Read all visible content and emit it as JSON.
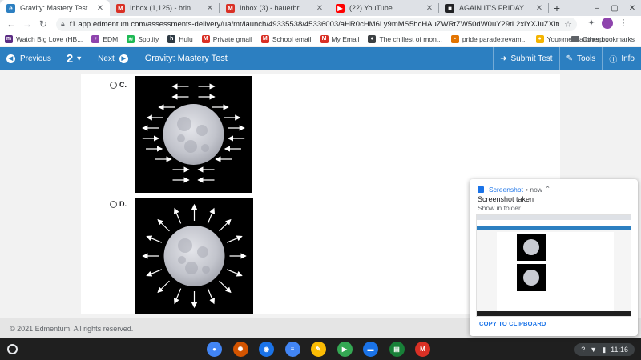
{
  "browser": {
    "tabs": [
      {
        "label": "Gravity: Mastery Test",
        "icon": "edmentum-icon",
        "active": true,
        "color": "#2c7fc1",
        "glyph": "e"
      },
      {
        "label": "Inbox (1,125) - brinnleybauer07",
        "icon": "gmail-icon",
        "active": false,
        "color": "#d93025",
        "glyph": "M"
      },
      {
        "label": "Inbox (3) - bauerbri6111@stude",
        "icon": "gmail-icon",
        "active": false,
        "color": "#d93025",
        "glyph": "M"
      },
      {
        "label": "(22) YouTube",
        "icon": "youtube-icon",
        "active": false,
        "color": "#ff0000",
        "glyph": "▶"
      },
      {
        "label": "AGAIN IT'S FRIDAY PEEPS (keyb",
        "icon": "page-icon",
        "active": false,
        "color": "#202124",
        "glyph": "■"
      }
    ],
    "new_tab": "+",
    "url": "f1.app.edmentum.com/assessments-delivery/ua/mt/launch/49335538/45336003/aHR0cHM6Ly9mMS5hcHAuZWRtZW50dW0uY29tL2xlYXJuZXItdWkvdXNlci1hc3NpZ25...",
    "bookmarks": [
      {
        "label": "Watch Big Love (HB...",
        "icon": "hbo-icon",
        "color": "#5b2c83",
        "glyph": "m"
      },
      {
        "label": "EDM",
        "icon": "edm-icon",
        "color": "#8e44ad",
        "glyph": "♀"
      },
      {
        "label": "Spotify",
        "icon": "spotify-icon",
        "color": "#1db954",
        "glyph": "≋"
      },
      {
        "label": "Hulu",
        "icon": "hulu-icon",
        "color": "#2f3b45",
        "glyph": "h"
      },
      {
        "label": "Private gmail",
        "icon": "gmail-icon",
        "color": "#d93025",
        "glyph": "M"
      },
      {
        "label": "School email",
        "icon": "gmail-icon",
        "color": "#d93025",
        "glyph": "M"
      },
      {
        "label": "My Email",
        "icon": "gmail-icon",
        "color": "#d93025",
        "glyph": "M"
      },
      {
        "label": "The chillest of mon...",
        "icon": "web-icon",
        "color": "#3c4043",
        "glyph": "●"
      },
      {
        "label": "pride parade:revam...",
        "icon": "picture-icon",
        "color": "#e37400",
        "glyph": "▪"
      },
      {
        "label": "Your meditation sp...",
        "icon": "meditation-icon",
        "color": "#f4b400",
        "glyph": "●"
      }
    ],
    "more_bookmarks": "»",
    "other_bookmarks": "Other bookmarks"
  },
  "edmentum": {
    "previous": "Previous",
    "page_number": "2",
    "next": "Next",
    "test_title": "Gravity: Mastery Test",
    "submit": "Submit Test",
    "tools": "Tools",
    "info": "Info"
  },
  "question": {
    "options": [
      {
        "label": "C.",
        "image": "moon-with-inward-arrows"
      },
      {
        "label": "D.",
        "image": "moon-with-outward-arrows"
      }
    ]
  },
  "footer": {
    "copyright": "© 2021 Edmentum. All rights reserved."
  },
  "notification": {
    "app": "Screenshot",
    "time": "• now",
    "title": "Screenshot taken",
    "subtitle": "Show in folder",
    "action": "COPY TO CLIPBOARD"
  },
  "shelf": {
    "apps": [
      {
        "name": "chrome-icon",
        "color": "#4285f4",
        "glyph": "●"
      },
      {
        "name": "app-icon-red",
        "color": "#d35400",
        "glyph": "✺"
      },
      {
        "name": "camera-icon",
        "color": "#1a73e8",
        "glyph": "◉"
      },
      {
        "name": "docs-icon",
        "color": "#4285f4",
        "glyph": "≡"
      },
      {
        "name": "keep-icon",
        "color": "#fbbc04",
        "glyph": "✎"
      },
      {
        "name": "play-store-icon",
        "color": "#34a853",
        "glyph": "▶"
      },
      {
        "name": "files-icon",
        "color": "#1a73e8",
        "glyph": "▬"
      },
      {
        "name": "classroom-icon",
        "color": "#188038",
        "glyph": "▤"
      },
      {
        "name": "gmail-icon",
        "color": "#d93025",
        "glyph": "M"
      }
    ],
    "time": "11:16"
  }
}
